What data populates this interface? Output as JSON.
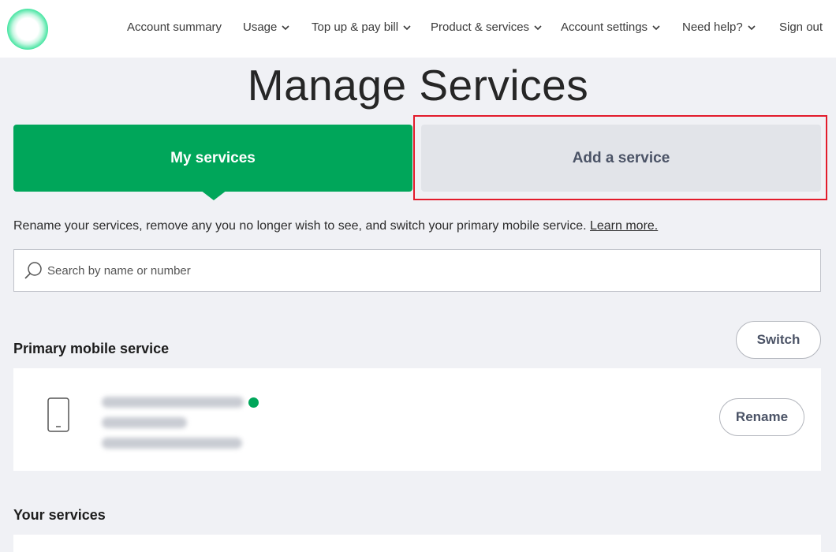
{
  "nav": {
    "items": [
      {
        "label": "Account summary",
        "dropdown": false
      },
      {
        "label": "Usage",
        "dropdown": true
      },
      {
        "label": "Top up & pay bill",
        "dropdown": true
      },
      {
        "label": "Product & services",
        "dropdown": true
      },
      {
        "label": "Account settings",
        "dropdown": true
      },
      {
        "label": "Need help?",
        "dropdown": true
      },
      {
        "label": "Sign out",
        "dropdown": false
      }
    ]
  },
  "page": {
    "title": "Manage Services"
  },
  "tabs": {
    "my_services": "My services",
    "add_service": "Add a service",
    "active": "my_services",
    "highlighted": "add_service"
  },
  "intro": {
    "text": "Rename your services, remove any you no longer wish to see, and switch your primary mobile service.",
    "link": "Learn more."
  },
  "search": {
    "placeholder": "Search by name or number",
    "value": ""
  },
  "primary": {
    "title": "Primary mobile service",
    "switch_label": "Switch",
    "rename_label": "Rename",
    "status": "active"
  },
  "your_services": {
    "title": "Your services"
  },
  "colors": {
    "brand_green": "#00a65a",
    "highlight_red": "#e31b2b",
    "tab_inactive": "#e2e4e9",
    "page_bg": "#f0f1f5"
  },
  "icons": {
    "logo": "brand-logo-ring",
    "search": "search-icon",
    "device": "mobile-phone-icon",
    "dropdown": "chevron-down-icon"
  }
}
